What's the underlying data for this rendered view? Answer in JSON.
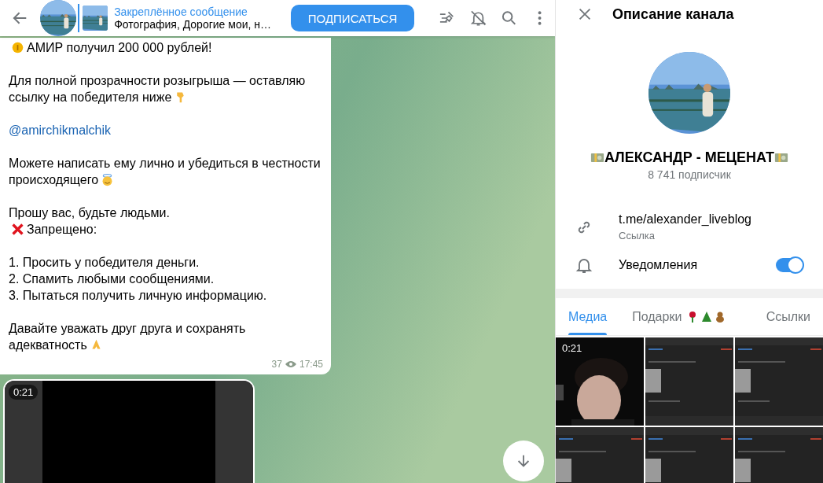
{
  "header": {
    "pinned_title": "Закреплённое сообщение",
    "pinned_text": "Фотография, Дорогие мои, н…",
    "subscribe_button": "ПОДПИСАТЬСЯ"
  },
  "message": {
    "paragraphs": [
      {
        "lines": [
          {
            "text": "АМИР получил 200 000 рублей!",
            "icon_before": {
              "kind": "coin"
            }
          }
        ]
      },
      {
        "lines": [
          {
            "text": "Для полной прозрачности розыгрыша — оставляю"
          },
          {
            "text": "ссылку на победителя ниже",
            "icon_after": {
              "kind": "hand-down"
            }
          }
        ]
      },
      {
        "lines": [
          {
            "text": "@amirchikmalchik",
            "kind": "link"
          }
        ]
      },
      {
        "lines": [
          {
            "text": "Можете написать ему лично и убедиться в честности"
          },
          {
            "text": "происходящего",
            "icon_after": {
              "kind": "angel"
            }
          }
        ]
      },
      {
        "lines": [
          {
            "text": "Прошу вас, будьте людьми."
          },
          {
            "text": "Запрещено:",
            "icon_before": {
              "kind": "cross"
            }
          }
        ]
      },
      {
        "lines": [
          {
            "text": "1. Просить у победителя деньги."
          },
          {
            "text": "2. Спамить любыми сообщениями."
          },
          {
            "text": "3. Пытаться получить личную информацию."
          }
        ]
      },
      {
        "lines": [
          {
            "text": "Давайте уважать друг друга и сохранять"
          },
          {
            "text": "адекватность",
            "icon_after": {
              "kind": "pray"
            }
          }
        ]
      }
    ],
    "views": "37",
    "time": "17:45"
  },
  "video": {
    "duration": "0:21"
  },
  "panel": {
    "title": "Описание канала",
    "channel_name": "АЛЕКСАНДР - МЕЦЕНАТ",
    "subscribers": "8 741 подписчик",
    "link": "t.me/alexander_liveblog",
    "link_caption": "Ссылка",
    "notifications": {
      "label": "Уведомления",
      "on": true
    }
  },
  "tabs": [
    {
      "label": "Медиа",
      "selected": true,
      "icons": false
    },
    {
      "label": "Подарки",
      "selected": false,
      "icons": true
    },
    {
      "label": "Ссылки",
      "selected": false,
      "icons": false
    }
  ],
  "media": [
    {
      "kind": "video",
      "duration": "0:21"
    },
    {
      "kind": "screenshot"
    },
    {
      "kind": "screenshot"
    },
    {
      "kind": "screenshot"
    },
    {
      "kind": "screenshot"
    },
    {
      "kind": "screenshot"
    }
  ]
}
